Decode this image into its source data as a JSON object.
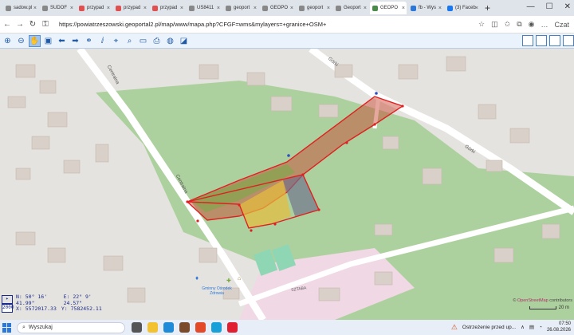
{
  "browser": {
    "tabs": [
      {
        "label": "sadow.pl",
        "color": "#888"
      },
      {
        "label": "SUDOF",
        "color": "#888"
      },
      {
        "label": "przypad",
        "color": "#e05050"
      },
      {
        "label": "przypad",
        "color": "#e05050"
      },
      {
        "label": "przypad",
        "color": "#e05050"
      },
      {
        "label": "US8411",
        "color": "#888"
      },
      {
        "label": "geoport",
        "color": "#888"
      },
      {
        "label": "GEOPO",
        "color": "#888"
      },
      {
        "label": "geoport",
        "color": "#888"
      },
      {
        "label": "Geoport",
        "color": "#888"
      },
      {
        "label": "GEOPO",
        "color": "#4a8a4a",
        "active": true
      },
      {
        "label": "fb - Wys",
        "color": "#2b78d8"
      },
      {
        "label": "(3) Faceb",
        "color": "#1877f2"
      }
    ],
    "url": "https://powiatrzeszowski.geoportal2.pl/map/www/mapa.php?CFGF=wms&mylayers=+granice+OSM+",
    "copilot_label": "Czat"
  },
  "map": {
    "streets": {
      "centralna": "Centralna",
      "gorki": "Górki",
      "gorki2": "Górki",
      "school": "SZTABA"
    },
    "poi_label": "Gminny Ośrodek Zdrowia"
  },
  "coordinates": {
    "n": "N: 50° 16' 41.99\"",
    "e": "E: 22° 9' 24.57\"",
    "x": "X: 5572017.33",
    "y": "Y: 7582452.11",
    "scale": "2000"
  },
  "attribution": {
    "prefix": "©",
    "link": "OpenStreetMap",
    "suffix": " contributors"
  },
  "scale_bar": "20 m",
  "taskbar": {
    "search_placeholder": "Wyszukaj",
    "notification": "Ostrzeżenie przed up...",
    "time": "07:50",
    "date": "26.08.2026"
  }
}
